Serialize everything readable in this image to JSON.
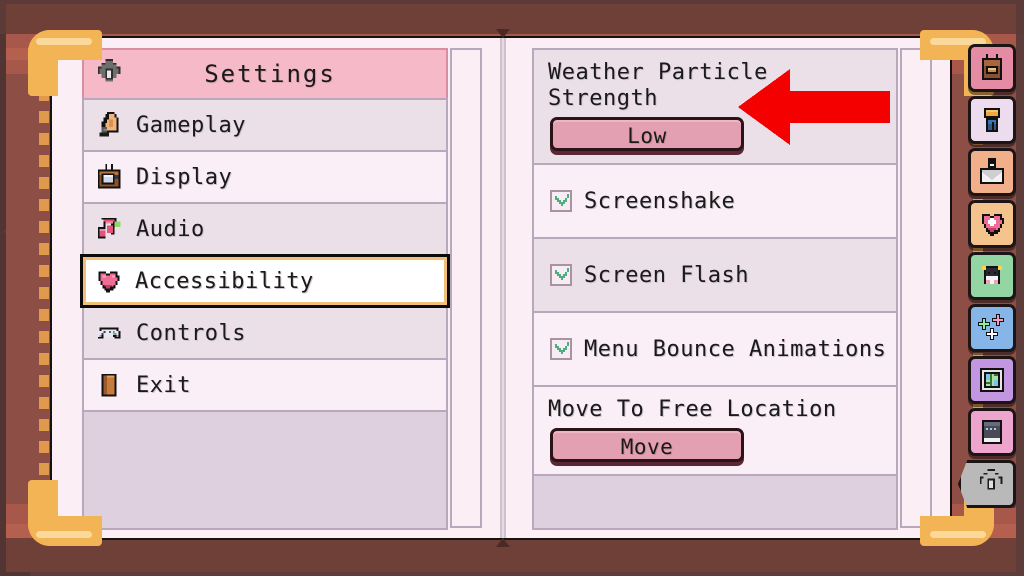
{
  "window": {
    "title": "Settings",
    "header_icon": "gear-icon"
  },
  "colors": {
    "book_cover": "#8d4f45",
    "page": "#fbeff5",
    "header_pink": "#f6b9c8",
    "button_pink": "#e3a0b2",
    "selected_gold": "#f0c07a",
    "arrow_red": "#f40000",
    "checkmark_green": "#4fae80"
  },
  "sidebar": {
    "items": [
      {
        "label": "Gameplay",
        "icon": "horse-chess-piece-icon",
        "selected": false
      },
      {
        "label": "Display",
        "icon": "television-icon",
        "selected": false
      },
      {
        "label": "Audio",
        "icon": "music-note-icon",
        "selected": false
      },
      {
        "label": "Accessibility",
        "icon": "heart-icon",
        "selected": true
      },
      {
        "label": "Controls",
        "icon": "gamepad-icon",
        "selected": false
      },
      {
        "label": "Exit",
        "icon": "door-icon",
        "selected": false
      }
    ]
  },
  "settings_panel": {
    "options": [
      {
        "type": "dropdown",
        "label": "Weather Particle Strength",
        "value": "Low",
        "name": "weather-particle-strength"
      },
      {
        "type": "checkbox",
        "label": "Screenshake",
        "checked": true,
        "name": "screenshake"
      },
      {
        "type": "checkbox",
        "label": "Screen Flash",
        "checked": true,
        "name": "screen-flash"
      },
      {
        "type": "checkbox",
        "label": "Menu Bounce Animations",
        "checked": true,
        "name": "menu-bounce-animations"
      },
      {
        "type": "button",
        "label": "Move To Free Location",
        "value": "Move",
        "name": "move-to-free-location"
      }
    ]
  },
  "tabs": [
    {
      "icon": "backpack-icon",
      "color": "#e38ca3",
      "active": false,
      "name": "inventory"
    },
    {
      "icon": "clothing-icon",
      "color": "#ecdcee",
      "active": false,
      "name": "wardrobe"
    },
    {
      "icon": "mail-icon",
      "color": "#f2b08a",
      "active": false,
      "name": "mail"
    },
    {
      "icon": "heart-icon",
      "color": "#f5c48c",
      "active": false,
      "name": "health"
    },
    {
      "icon": "creature-icon",
      "color": "#93d6a4",
      "active": false,
      "name": "critters"
    },
    {
      "icon": "sparkle-icon",
      "color": "#86b6e8",
      "active": false,
      "name": "magic"
    },
    {
      "icon": "map-icon",
      "color": "#c296e0",
      "active": false,
      "name": "map"
    },
    {
      "icon": "book-icon",
      "color": "#eda4cd",
      "active": false,
      "name": "journal"
    },
    {
      "icon": "gear-icon",
      "color": "#b9b9b9",
      "active": true,
      "name": "settings"
    }
  ],
  "annotation": {
    "arrow": "red-left-pointing-arrow",
    "points_at": "Low"
  }
}
